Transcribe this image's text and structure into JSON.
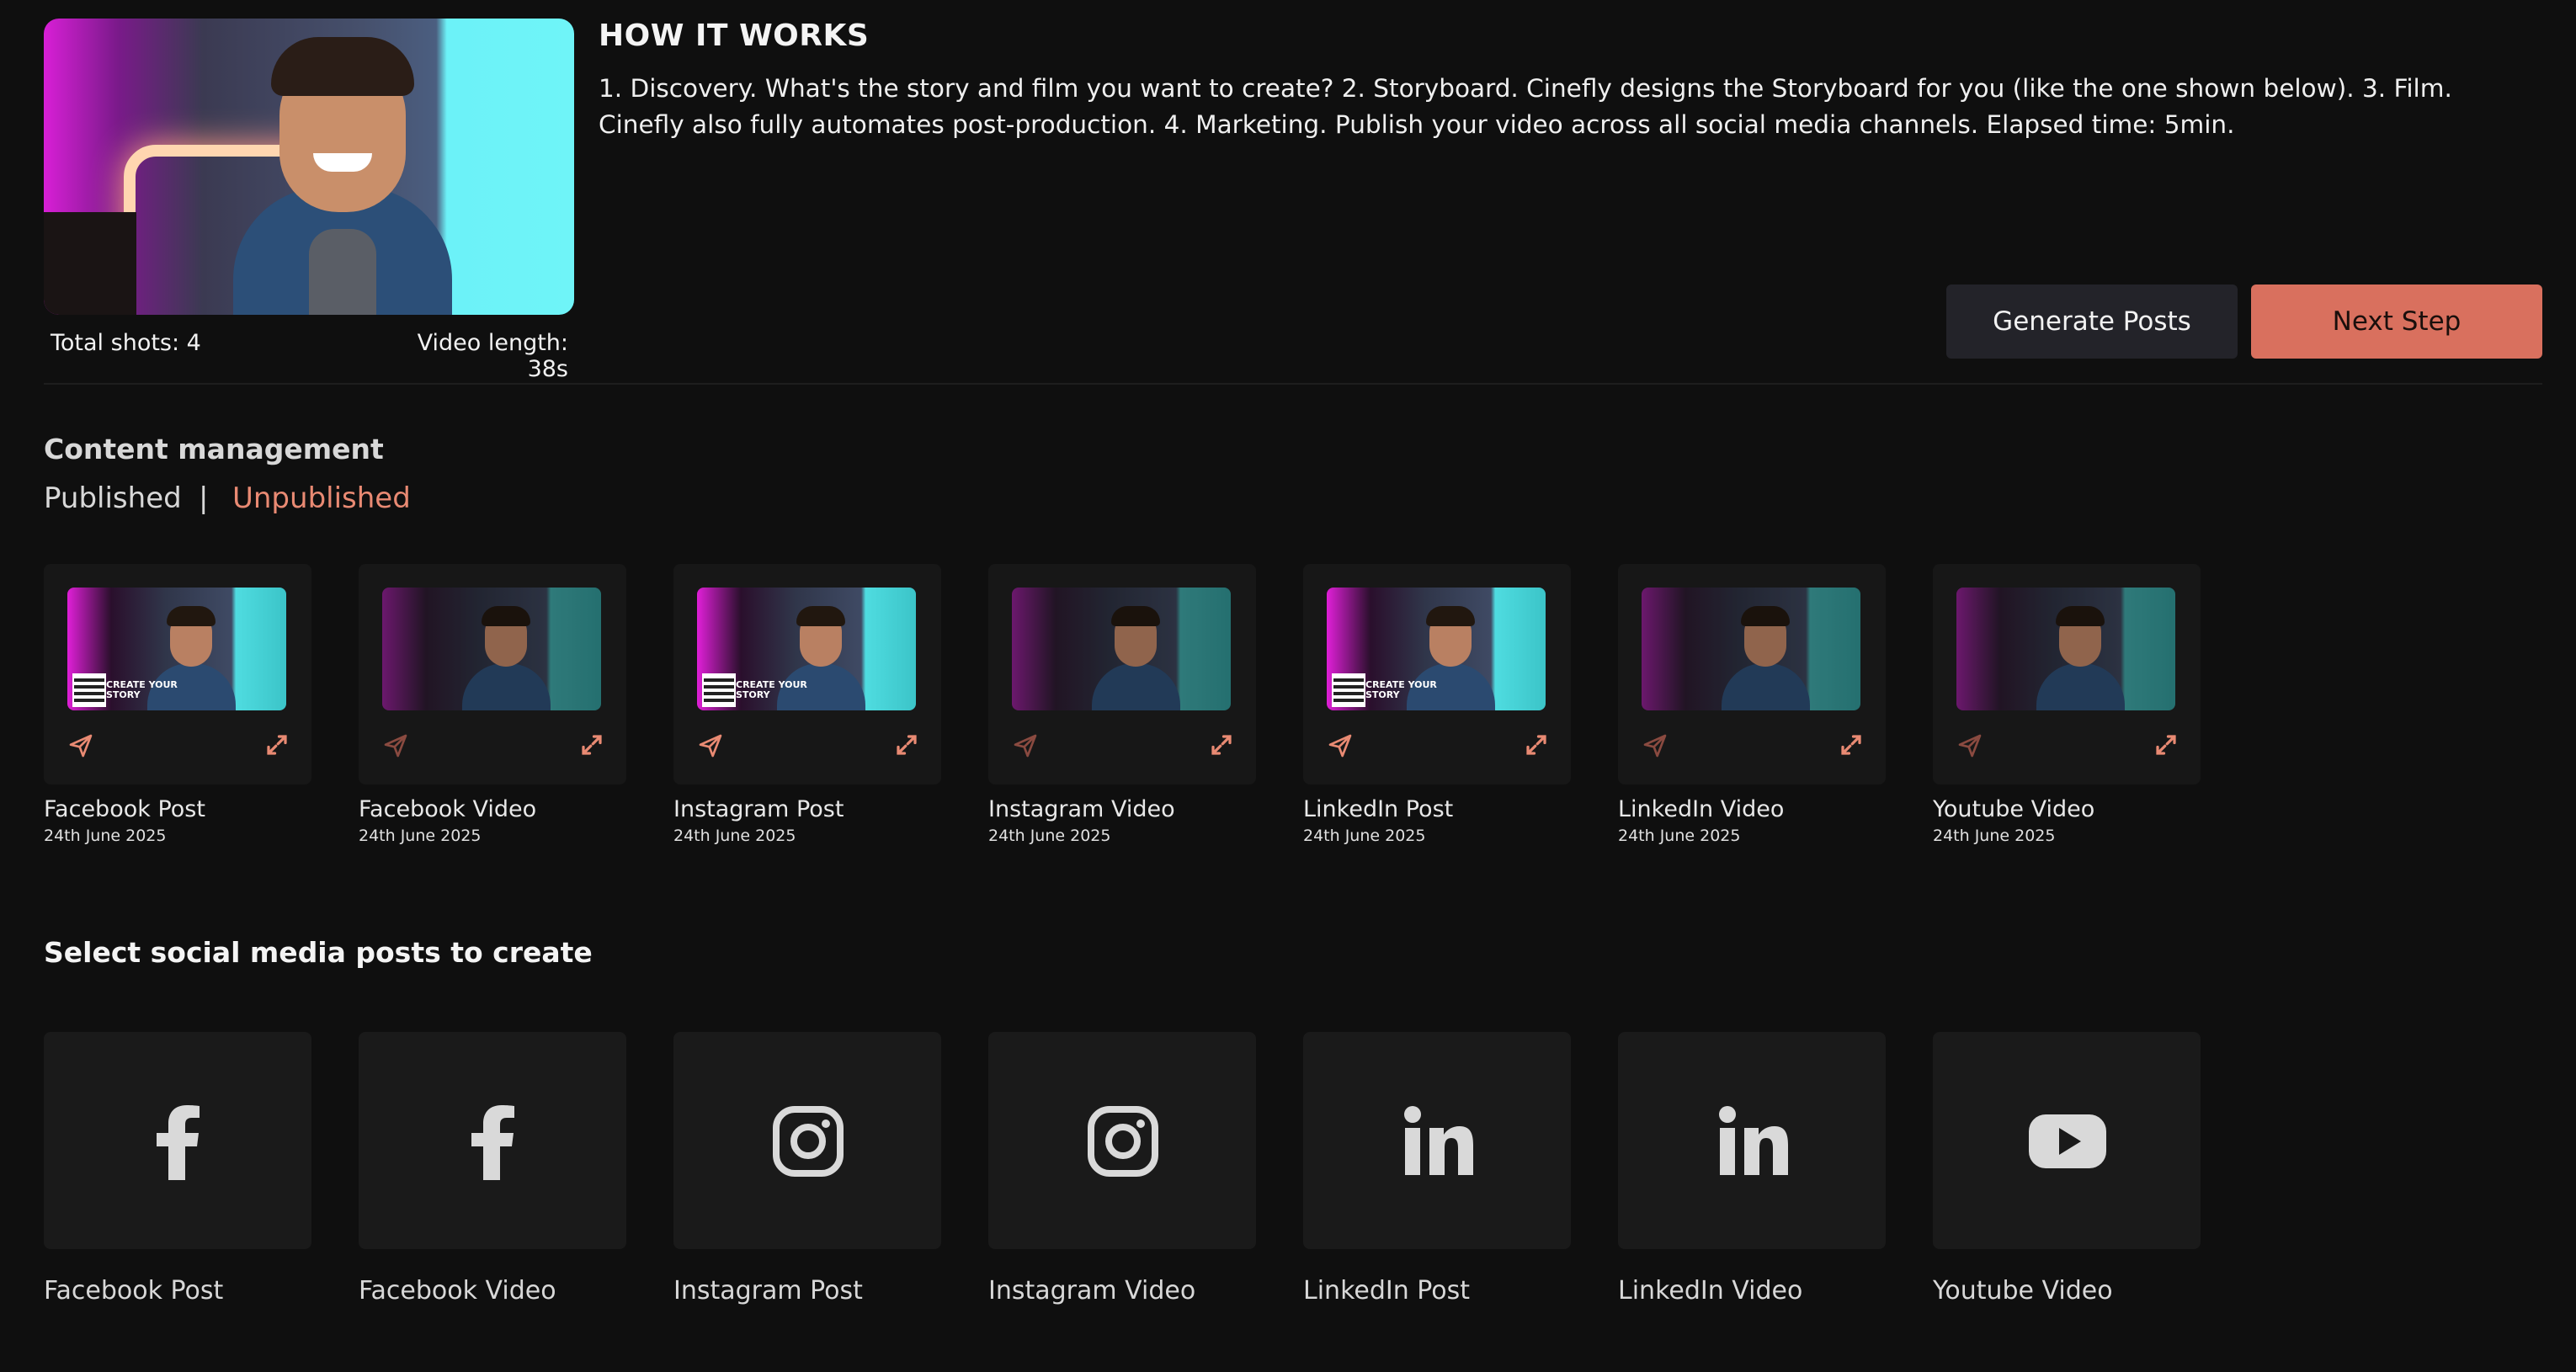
{
  "hero": {
    "total_shots": "Total shots: 4",
    "video_length": "Video length: 38s"
  },
  "how_it_works": {
    "title": "HOW IT WORKS",
    "text": "1. Discovery. What's the story and film you want to create? 2. Storyboard. Cinefly designs the Storyboard for you (like the one shown below). 3. Film. Cinefly also fully automates post-production. 4. Marketing. Publish your video across all social media channels. Elapsed time: 5min."
  },
  "buttons": {
    "generate": "Generate Posts",
    "next": "Next Step"
  },
  "content_management": {
    "title": "Content management",
    "tab_published": "Published",
    "tab_separator": "|",
    "tab_unpublished": "Unpublished",
    "overlay_text": "CREATE YOUR STORY",
    "cards": [
      {
        "title": "Facebook Post",
        "date": "24th June 2025"
      },
      {
        "title": "Facebook Video",
        "date": "24th June 2025"
      },
      {
        "title": "Instagram Post",
        "date": "24th June 2025"
      },
      {
        "title": "Instagram Video",
        "date": "24th June 2025"
      },
      {
        "title": "LinkedIn Post",
        "date": "24th June 2025"
      },
      {
        "title": "LinkedIn Video",
        "date": "24th June 2025"
      },
      {
        "title": "Youtube Video",
        "date": "24th June 2025"
      }
    ]
  },
  "select_posts": {
    "title": "Select social media posts to create",
    "tiles": [
      {
        "label": "Facebook Post",
        "icon": "facebook-icon"
      },
      {
        "label": "Facebook Video",
        "icon": "facebook-icon"
      },
      {
        "label": "Instagram Post",
        "icon": "instagram-icon"
      },
      {
        "label": "Instagram Video",
        "icon": "instagram-icon"
      },
      {
        "label": "LinkedIn Post",
        "icon": "linkedin-icon"
      },
      {
        "label": "LinkedIn Video",
        "icon": "linkedin-icon"
      },
      {
        "label": "Youtube Video",
        "icon": "youtube-icon"
      }
    ]
  },
  "colors": {
    "background": "#0f0f0f",
    "accent": "#d9705e",
    "accent_text": "#e98a73",
    "card": "#171717"
  }
}
